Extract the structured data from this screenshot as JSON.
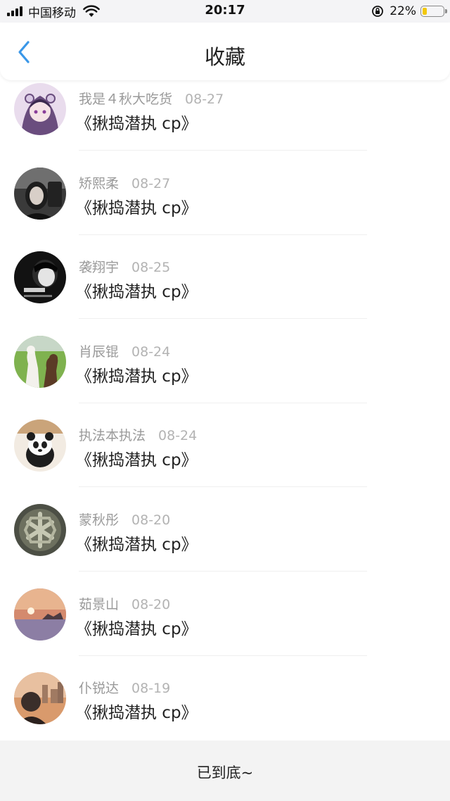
{
  "status_bar": {
    "carrier": "中国移动",
    "time": "20:17",
    "battery_percent": "22%",
    "battery_level": 0.22,
    "battery_color": "#f2c80c"
  },
  "nav": {
    "back_icon": "chevron-left-icon",
    "title": "收藏",
    "accent_color": "#3a97e8"
  },
  "items": [
    {
      "user": "我是４秋大吃货",
      "date": "08-27",
      "content": "《揪捣潜执 cp》"
    },
    {
      "user": "矫熙柔",
      "date": "08-27",
      "content": "《揪捣潜执 cp》"
    },
    {
      "user": "袭翔宇",
      "date": "08-25",
      "content": "《揪捣潜执 cp》"
    },
    {
      "user": "肖辰锟",
      "date": "08-24",
      "content": "《揪捣潜执 cp》"
    },
    {
      "user": "执法本执法",
      "date": "08-24",
      "content": "《揪捣潜执 cp》"
    },
    {
      "user": "蒙秋彤",
      "date": "08-20",
      "content": "《揪捣潜执 cp》"
    },
    {
      "user": "茹景山",
      "date": "08-20",
      "content": "《揪捣潜执 cp》"
    },
    {
      "user": "仆锐达",
      "date": "08-19",
      "content": "《揪捣潜执 cp》"
    }
  ],
  "footer": {
    "end_text": "已到底~"
  }
}
